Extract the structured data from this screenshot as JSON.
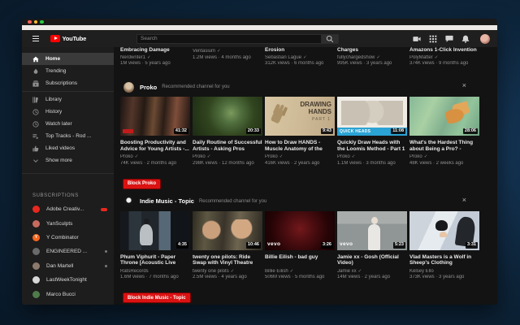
{
  "app_title": "YouTube",
  "colors": {
    "accent_red": "#e60000",
    "brand_red": "#ff0000",
    "desktop_background": "#0d2439",
    "header_background": "#1f1f1f",
    "banner_blue": "#2ba3d4"
  },
  "misc": {
    "verified_glyph": "✓",
    "close_glyph": "×"
  },
  "header": {
    "logo_text": "YouTube",
    "search_placeholder": "Search",
    "icons": [
      "video-upload",
      "apps-grid",
      "messages",
      "notifications"
    ]
  },
  "sidebar": {
    "items": [
      {
        "label": "Home",
        "icon": "home",
        "active": true
      },
      {
        "label": "Trending",
        "icon": "trending"
      },
      {
        "label": "Subscriptions",
        "icon": "subscriptions"
      },
      {
        "type": "divider"
      },
      {
        "label": "Library",
        "icon": "library"
      },
      {
        "label": "History",
        "icon": "history"
      },
      {
        "label": "Watch later",
        "icon": "watch-later"
      },
      {
        "label": "Top Tracks - Rod ...",
        "icon": "playlist"
      },
      {
        "label": "Liked videos",
        "icon": "liked"
      },
      {
        "label": "Show more",
        "icon": "chevron-down"
      }
    ],
    "subscriptions_label": "SUBSCRIPTIONS",
    "subscriptions": [
      {
        "name": "Adobe Creativ...",
        "color": "#e8281f",
        "indicator": "badge"
      },
      {
        "name": "YanSculpts",
        "color": "#c96a5f"
      },
      {
        "name": "Y Combinator",
        "color": "#fb651e",
        "letter": "Y"
      },
      {
        "name": "ENGINEERED ...",
        "color": "#6a6a6a",
        "indicator": "dot"
      },
      {
        "name": "Dan Martell",
        "color": "#8d7a6d",
        "indicator": "dot"
      },
      {
        "name": "LastWeekTonight",
        "color": "#d8d8d8"
      },
      {
        "name": "Marco Bucci",
        "color": "#4f7a4a"
      }
    ]
  },
  "top_row": [
    {
      "title": "Embracing Damage",
      "channel": "Nerdwriter1",
      "verified": true,
      "meta": "1M views · 5 years ago"
    },
    {
      "title": "",
      "channel": "Veritasium",
      "verified": true,
      "meta": "1.2M views · 4 months ago"
    },
    {
      "title": "Erosion",
      "channel": "Sebastian Lague",
      "verified": true,
      "meta": "312K views · 6 months ago"
    },
    {
      "title": "Charges",
      "channel": "fullychargedshow",
      "verified": true,
      "meta": "995K views · 3 years ago"
    },
    {
      "title": "Amazons 1-Click Invention",
      "channel": "PolyMatter",
      "verified": true,
      "meta": "374K views · 9 months ago"
    }
  ],
  "sections": [
    {
      "channel_name": "Proko",
      "note": "Recommended channel for you",
      "block_label": "Block Proko",
      "avatar": "proko",
      "videos": [
        {
          "title": "Boosting Productivity and Advice for Young Artists -...",
          "channel": "Proko",
          "verified": true,
          "meta": "74K views · 2 months ago",
          "duration": "41:32",
          "thumb": "studio-interview"
        },
        {
          "title": "Daily Routine of Successful Artists - Asking Pros",
          "channel": "Proko",
          "verified": true,
          "meta": "298K views · 12 months ago",
          "duration": "20:33",
          "thumb": "sculpture"
        },
        {
          "title": "How to Draw HANDS - Muscle Anatomy of the Hand",
          "channel": "Proko",
          "verified": true,
          "meta": "416K views · 2 years ago",
          "duration": "9:43",
          "thumb": "drawing-hands",
          "thumb_text": "DRAWING HANDS",
          "thumb_subtext": "PART 1"
        },
        {
          "title": "Quickly Draw Heads with the Loomis Method - Part 1",
          "channel": "Proko",
          "verified": true,
          "meta": "1.1M views · 3 months ago",
          "duration": "11:08",
          "thumb": "loomis-heads",
          "thumb_banner": "QUICK HEADS"
        },
        {
          "title": "What's the Hardest Thing about Being a Pro? - Asking...",
          "channel": "Proko",
          "verified": true,
          "meta": "48K views · 2 weeks ago",
          "duration": "28:06",
          "thumb": "tiger-art"
        }
      ]
    },
    {
      "channel_name": "Indie Music - Topic",
      "note": "Recommended channel for you",
      "block_label": "Block Indie Music - Topic",
      "avatar": "indie",
      "videos": [
        {
          "title": "Phum Viphurit - Paper Throne [Acoustic Live Session]",
          "channel": "RatsRecords",
          "verified": false,
          "meta": "1.6M views · 7 months ago",
          "duration": "4:35",
          "thumb": "guitar-session"
        },
        {
          "title": "twenty one pilots: Ride Swap with Vinyl Theatre",
          "channel": "twenty one pilots",
          "verified": true,
          "meta": "2.5M views · 4 years ago",
          "duration": "10:46",
          "thumb": "office-interview"
        },
        {
          "title": "Billie Eilish - bad guy",
          "channel": "Billie Eilish",
          "verified": true,
          "meta": "506M views · 5 months ago",
          "duration": "3:26",
          "thumb": "badguy-red",
          "watermark": "vevo"
        },
        {
          "title": "Jamie xx - Gosh (Official Video)",
          "channel": "Jamie xx",
          "verified": true,
          "meta": "14M views · 2 years ago",
          "duration": "5:23",
          "thumb": "gosh-gray",
          "watermark": "vevo"
        },
        {
          "title": "Vlad Masters is a Wolf in Sheep's Clothing",
          "channel": "Kelsey Ello",
          "verified": false,
          "meta": "373K views · 3 years ago",
          "duration": "3:31",
          "thumb": "cartoon-danny"
        }
      ]
    }
  ]
}
